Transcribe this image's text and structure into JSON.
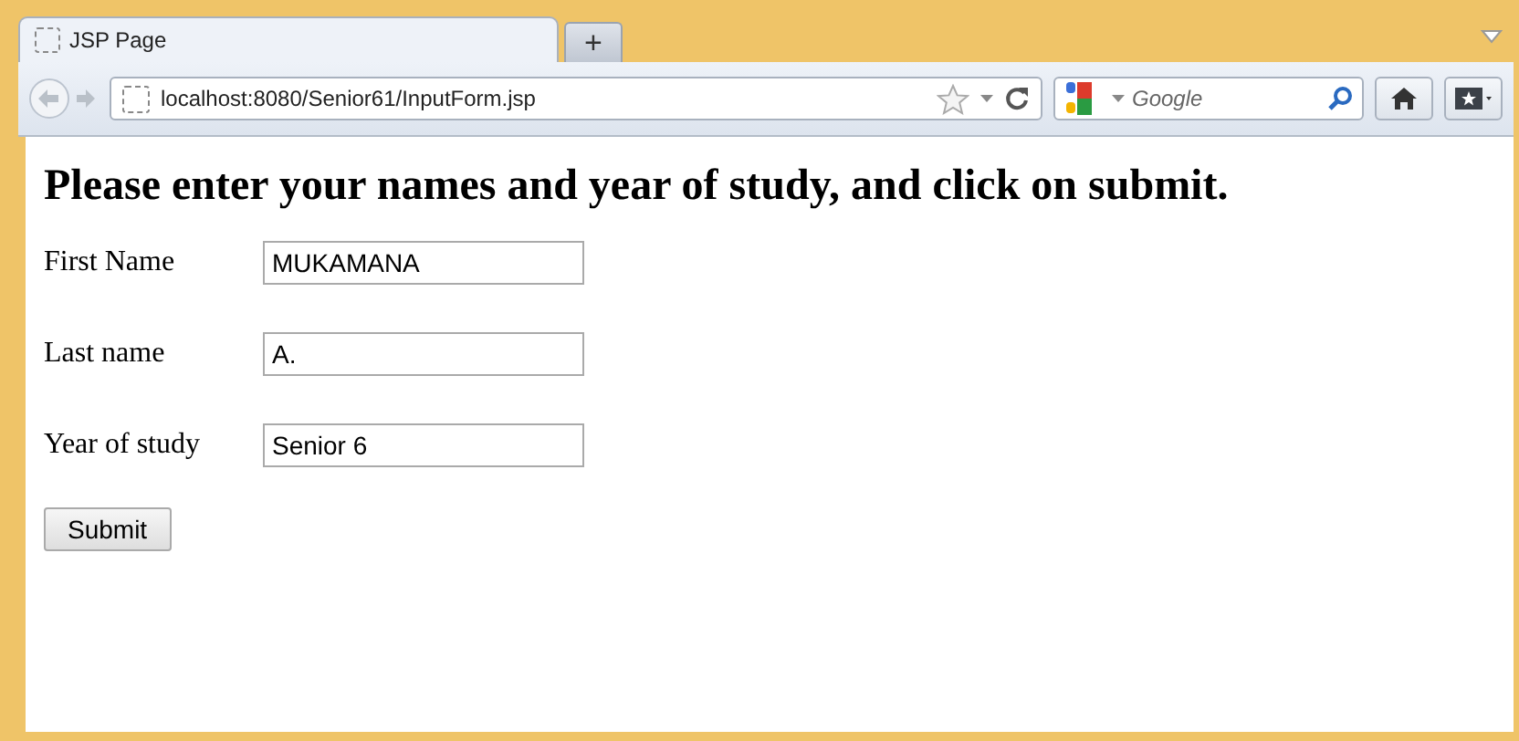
{
  "tabs": [
    {
      "title": "JSP Page",
      "selected": true
    }
  ],
  "new_tab": "+",
  "address_bar": {
    "url": "localhost:8080/Senior61/InputForm.jsp"
  },
  "search": {
    "placeholder": "Google"
  },
  "page": {
    "heading": "Please enter your names and year of study, and click on submit.",
    "fields": [
      {
        "label": "First Name",
        "value": "MUKAMANA"
      },
      {
        "label": "Last name",
        "value": "A."
      },
      {
        "label": "Year of study",
        "value": "Senior 6"
      }
    ],
    "submit": "Submit"
  }
}
